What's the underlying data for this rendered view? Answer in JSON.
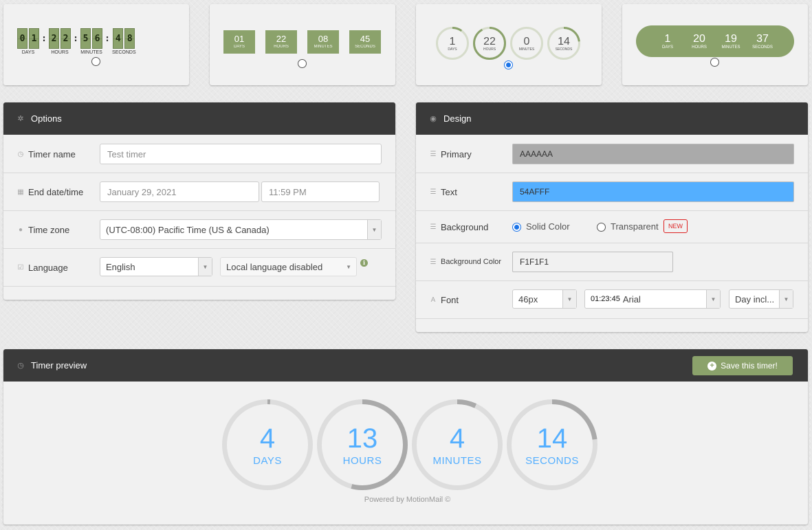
{
  "colors": {
    "accent_green": "#8ba26b",
    "header_dark": "#3a3a3a",
    "primary": "#AAAAAA",
    "text": "#54AFFF",
    "background": "#F1F1F1",
    "badge_red": "#dd2222"
  },
  "timer_styles": [
    {
      "selected": false,
      "units": [
        {
          "digits": [
            "0",
            "1"
          ],
          "label": "DAYS"
        },
        {
          "digits": [
            "2",
            "2"
          ],
          "label": "HOURS"
        },
        {
          "digits": [
            "5",
            "6"
          ],
          "label": "MINUTES"
        },
        {
          "digits": [
            "4",
            "8"
          ],
          "label": "SECONDS"
        }
      ],
      "separator": ":"
    },
    {
      "selected": false,
      "units": [
        {
          "value": "01",
          "label": "DAYS"
        },
        {
          "value": "22",
          "label": "HOURS"
        },
        {
          "value": "08",
          "label": "MINUTES"
        },
        {
          "value": "45",
          "label": "SECONDS"
        }
      ]
    },
    {
      "selected": true,
      "units": [
        {
          "value": "1",
          "label": "DAYS",
          "progress": 0.1
        },
        {
          "value": "22",
          "label": "HOURS",
          "progress": 0.92
        },
        {
          "value": "0",
          "label": "MINUTES",
          "progress": 0.0
        },
        {
          "value": "14",
          "label": "SECONDS",
          "progress": 0.23
        }
      ]
    },
    {
      "selected": false,
      "units": [
        {
          "value": "1",
          "label": "DAYS"
        },
        {
          "value": "20",
          "label": "HOURS"
        },
        {
          "value": "19",
          "label": "MINUTES"
        },
        {
          "value": "37",
          "label": "SECONDS"
        }
      ]
    }
  ],
  "options": {
    "title": "Options",
    "icon": "gear-icon",
    "timer_name": {
      "label": "Timer name",
      "placeholder": "Test timer",
      "icon": "clock-icon"
    },
    "end_datetime": {
      "label": "End date/time",
      "date": "January 29, 2021",
      "time": "11:59 PM",
      "icon": "calendar-icon"
    },
    "time_zone": {
      "label": "Time zone",
      "value": "(UTC-08:00) Pacific Time (US & Canada)",
      "icon": "globe-icon"
    },
    "language": {
      "label": "Language",
      "value": "English",
      "local": "Local language disabled",
      "icon": "check-icon",
      "info_icon": "info-icon"
    }
  },
  "design": {
    "title": "Design",
    "icon": "eye-icon",
    "primary": {
      "label": "Primary",
      "value": "AAAAAA"
    },
    "text": {
      "label": "Text",
      "value": "54AFFF"
    },
    "background": {
      "label": "Background",
      "option_solid": "Solid Color",
      "option_transparent": "Transparent",
      "selected": "solid",
      "badge": "NEW"
    },
    "background_color": {
      "label": "Background Color",
      "value": "F1F1F1"
    },
    "font": {
      "label": "Font",
      "size": "46px",
      "family_sample": "01:23:45",
      "family": "Arial",
      "day": "Day incl..."
    }
  },
  "preview": {
    "title": "Timer preview",
    "icon": "clock-icon",
    "save_label": "Save this timer!",
    "units": [
      {
        "value": "4",
        "label": "DAYS",
        "progress": 0.01
      },
      {
        "value": "13",
        "label": "HOURS",
        "progress": 0.54
      },
      {
        "value": "4",
        "label": "MINUTES",
        "progress": 0.07
      },
      {
        "value": "14",
        "label": "SECONDS",
        "progress": 0.23
      }
    ],
    "powered_by": "Powered by MotionMail ©"
  }
}
